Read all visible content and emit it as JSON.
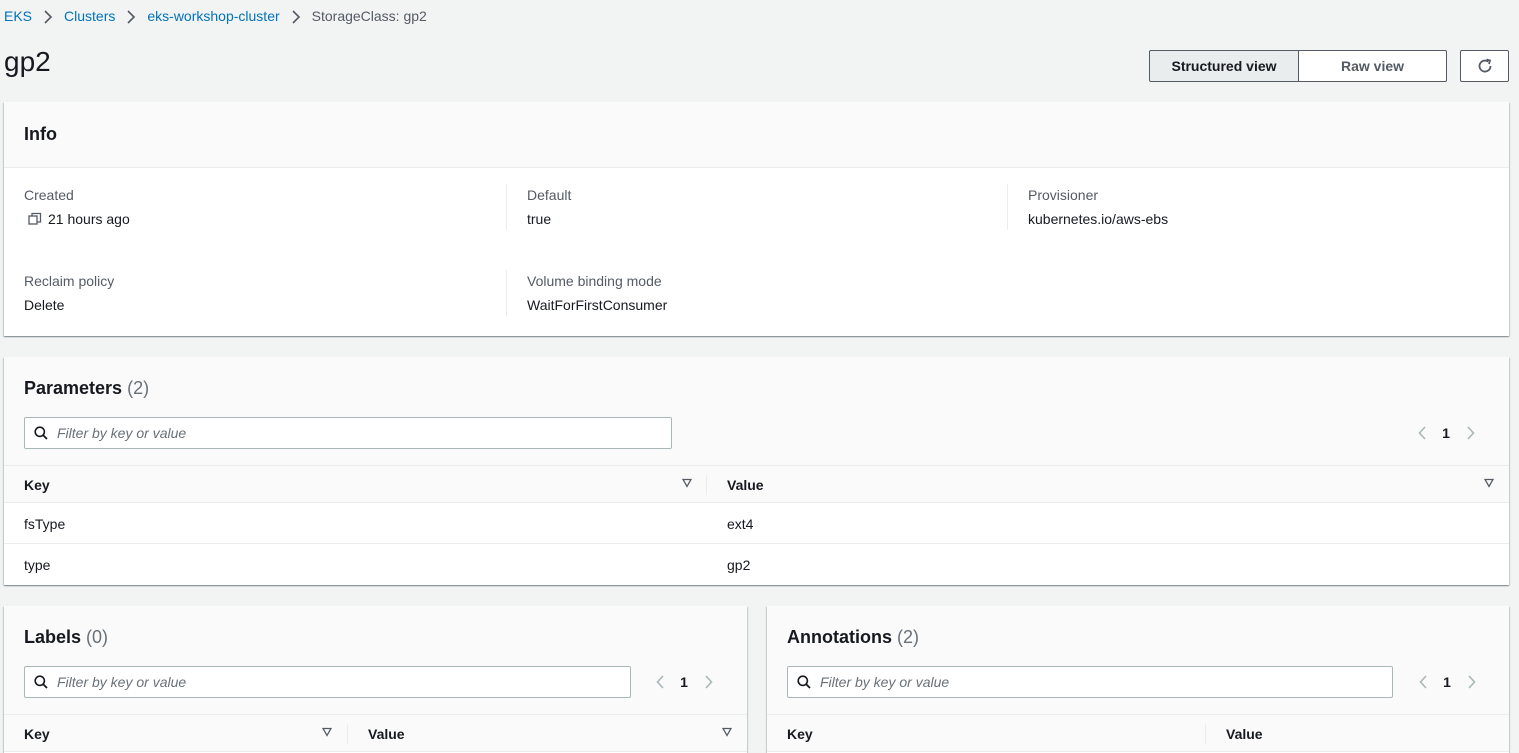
{
  "breadcrumb": {
    "items": [
      "EKS",
      "Clusters",
      "eks-workshop-cluster"
    ],
    "current": "StorageClass: gp2"
  },
  "page": {
    "title": "gp2"
  },
  "view_toggle": {
    "structured_label": "Structured view",
    "raw_label": "Raw view",
    "selected": "Structured view"
  },
  "info": {
    "title": "Info",
    "fields": {
      "created": {
        "label": "Created",
        "value": "21 hours ago"
      },
      "default": {
        "label": "Default",
        "value": "true"
      },
      "provisioner": {
        "label": "Provisioner",
        "value": "kubernetes.io/aws-ebs"
      },
      "reclaim_policy": {
        "label": "Reclaim policy",
        "value": "Delete"
      },
      "volume_binding_mode": {
        "label": "Volume binding mode",
        "value": "WaitForFirstConsumer"
      }
    }
  },
  "parameters": {
    "title": "Parameters",
    "count": "(2)",
    "filter_placeholder": "Filter by key or value",
    "page": "1",
    "columns": [
      "Key",
      "Value"
    ],
    "rows": [
      {
        "key": "fsType",
        "value": "ext4"
      },
      {
        "key": "type",
        "value": "gp2"
      }
    ]
  },
  "labels": {
    "title": "Labels",
    "count": "(0)",
    "filter_placeholder": "Filter by key or value",
    "page": "1",
    "columns": [
      "Key",
      "Value"
    ]
  },
  "annotations": {
    "title": "Annotations",
    "count": "(2)",
    "filter_placeholder": "Filter by key or value",
    "page": "1",
    "columns": [
      "Key",
      "Value"
    ]
  },
  "colors": {
    "link": "#0073bb",
    "background": "#f2f3f3",
    "text": "#16191f",
    "muted": "#545b64"
  }
}
